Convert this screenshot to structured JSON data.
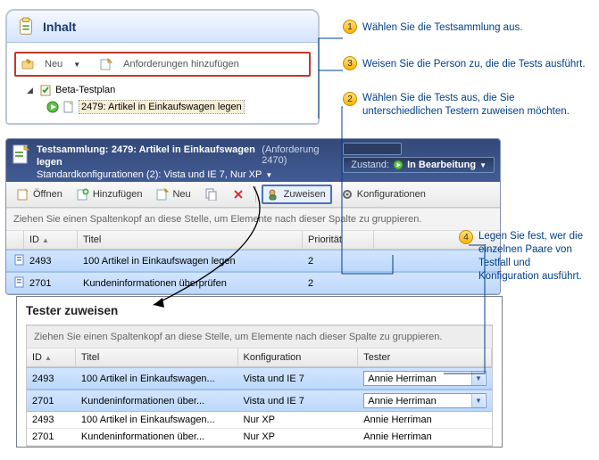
{
  "callouts": {
    "c1": {
      "num": "1",
      "text": "Wählen Sie die Testsammlung aus."
    },
    "c2": {
      "num": "2",
      "text": "Wählen Sie die Tests aus, die Sie unterschiedlichen Testern zuweisen möchten."
    },
    "c3": {
      "num": "3",
      "text": "Weisen Sie die Person zu, die die Tests ausführt."
    },
    "c4": {
      "num": "4",
      "text": "Legen Sie fest, wer die einzelnen Paare von Testfall und Konfiguration ausführt."
    }
  },
  "panel1": {
    "title": "Inhalt",
    "new_btn": "Neu",
    "add_req_btn": "Anforderungen hinzufügen",
    "tree": {
      "plan": "Beta-Testplan",
      "node": "2479: Artikel in Einkaufswagen legen"
    }
  },
  "panel2": {
    "suite_label": "Testsammlung:",
    "suite_name": "2479: Artikel in Einkaufswagen legen",
    "req": "(Anforderung 2470)",
    "configs": "Standardkonfigurationen (2): Vista und IE 7, Nur XP",
    "state_label": "Zustand:",
    "state_value": "In Bearbeitung",
    "toolbar": {
      "open": "Öffnen",
      "add": "Hinzufügen",
      "new": "Neu",
      "assign": "Zuweisen",
      "configs": "Konfigurationen"
    },
    "group_hint": "Ziehen Sie einen Spaltenkopf an diese Stelle, um Elemente nach dieser Spalte zu gruppieren.",
    "columns": {
      "id": "ID",
      "title": "Titel",
      "priority": "Priorität"
    },
    "rows": [
      {
        "id": "2493",
        "title": "100 Artikel in Einkaufswagen legen",
        "priority": "2"
      },
      {
        "id": "2701",
        "title": "Kundeninformationen überprüfen",
        "priority": "2"
      }
    ]
  },
  "panel3": {
    "title": "Tester zuweisen",
    "group_hint": "Ziehen Sie einen Spaltenkopf an diese Stelle, um Elemente nach dieser Spalte zu gruppieren.",
    "columns": {
      "id": "ID",
      "title": "Titel",
      "config": "Konfiguration",
      "tester": "Tester"
    },
    "rows": [
      {
        "id": "2493",
        "title": "100 Artikel in Einkaufswagen...",
        "config": "Vista und IE 7",
        "tester": "Annie Herriman",
        "sel": true
      },
      {
        "id": "2701",
        "title": "Kundeninformationen über...",
        "config": "Vista und IE 7",
        "tester": "Annie Herriman",
        "sel": true
      },
      {
        "id": "2493",
        "title": "100 Artikel in Einkaufswagen...",
        "config": "Nur XP",
        "tester": "Annie Herriman",
        "sel": false
      },
      {
        "id": "2701",
        "title": "Kundeninformationen über...",
        "config": "Nur XP",
        "tester": "Annie Herriman",
        "sel": false
      }
    ]
  }
}
